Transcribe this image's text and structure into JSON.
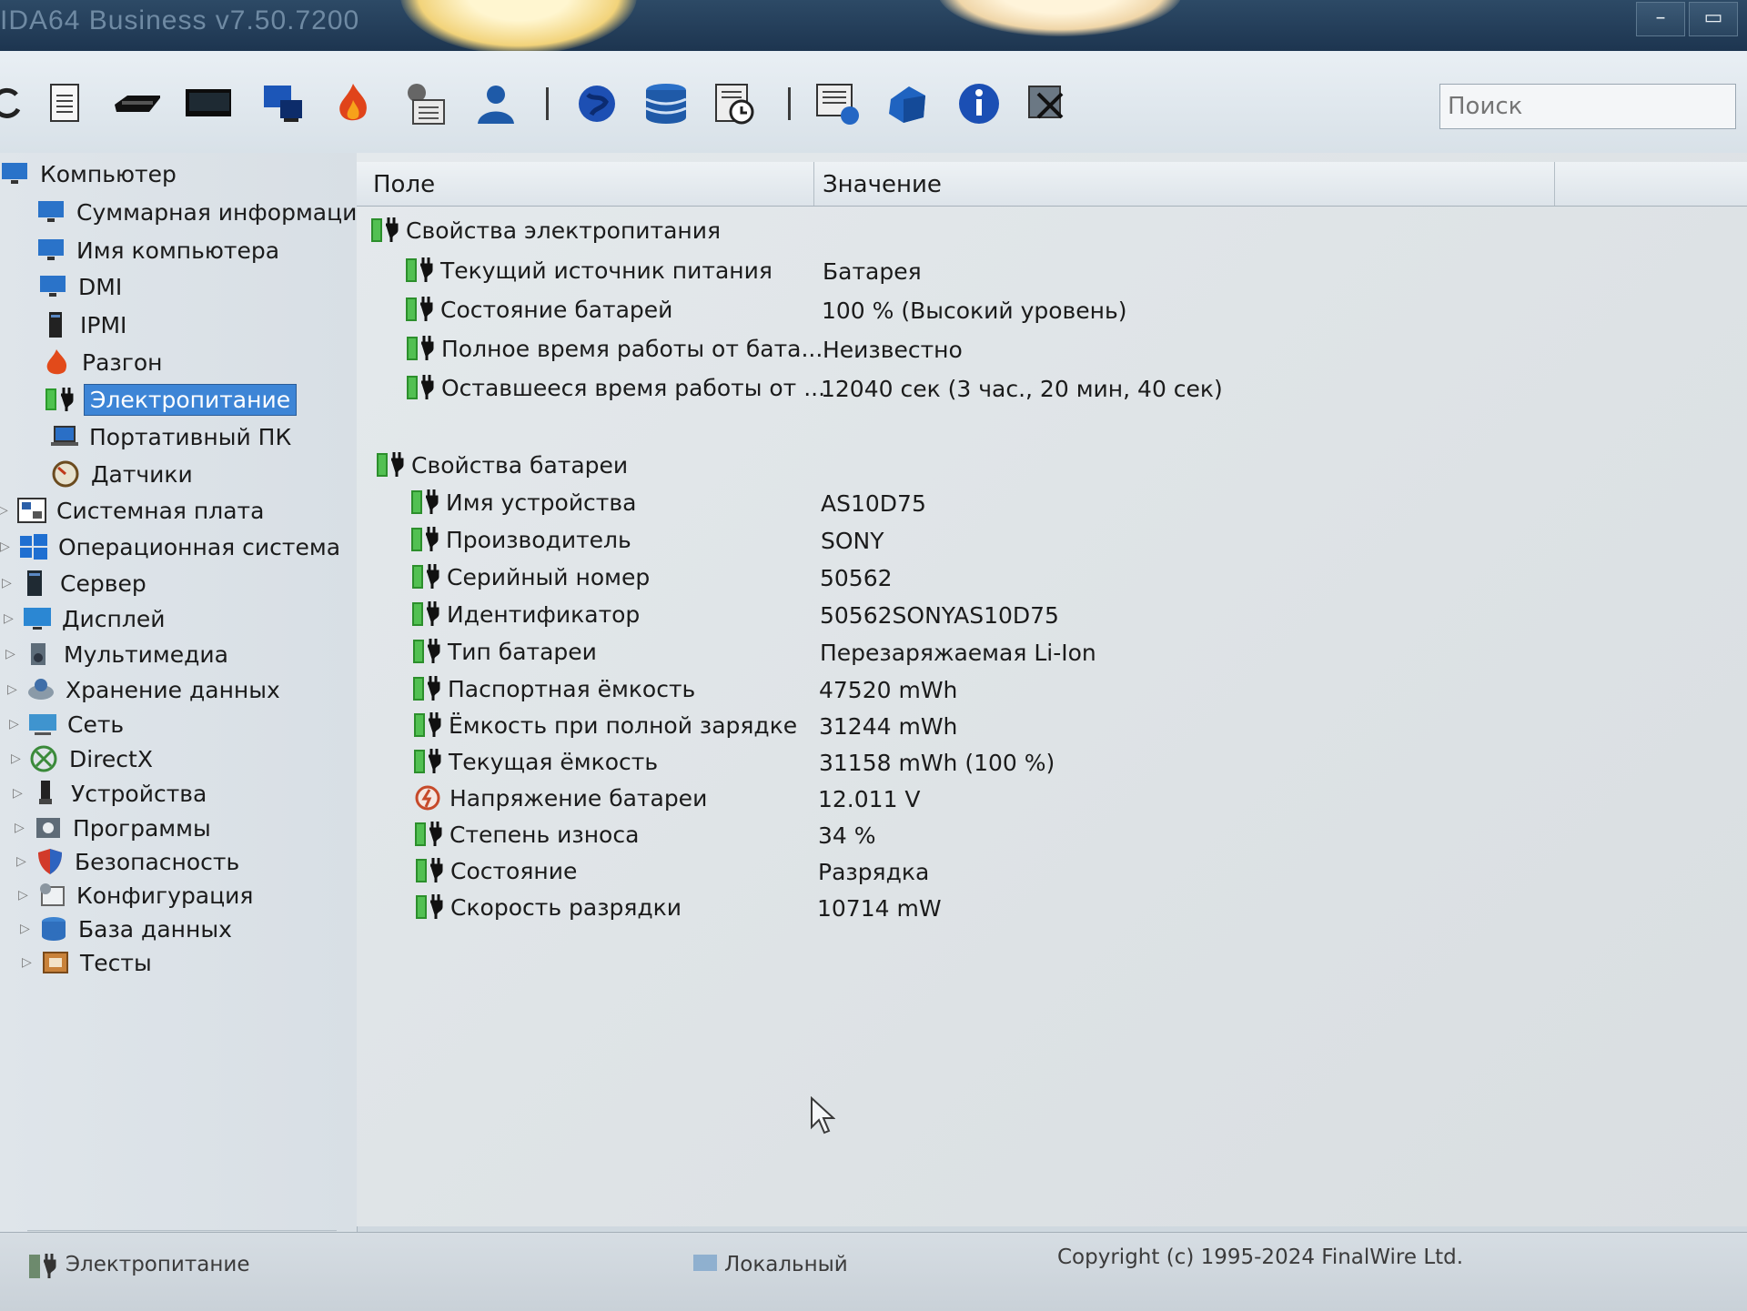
{
  "window": {
    "title": "IDA64 Business v7.50.7200"
  },
  "search": {
    "placeholder": "Поиск"
  },
  "toolbar_icons": [
    "refresh-icon",
    "report-icon",
    "memory-icon",
    "motherboard-icon",
    "computer-icon",
    "flame-icon",
    "settings-icon",
    "user-icon",
    "globe-icon",
    "database-icon",
    "schedule-icon",
    "network-report-icon",
    "network-icon",
    "info-icon",
    "tools-icon"
  ],
  "tree": {
    "root": "Компьютер",
    "computer_children": [
      {
        "label": "Суммарная информаци",
        "icon": "monitor-icon"
      },
      {
        "label": "Имя компьютера",
        "icon": "monitor-icon"
      },
      {
        "label": "DMI",
        "icon": "monitor-icon"
      },
      {
        "label": "IPMI",
        "icon": "server-icon"
      },
      {
        "label": "Разгон",
        "icon": "flame-icon"
      },
      {
        "label": "Электропитание",
        "icon": "battery-icon",
        "selected": true
      },
      {
        "label": "Портативный ПК",
        "icon": "laptop-icon"
      },
      {
        "label": "Датчики",
        "icon": "gauge-icon"
      }
    ],
    "top_level": [
      {
        "label": "Системная плата",
        "icon": "motherboard-icon"
      },
      {
        "label": "Операционная система",
        "icon": "windows-icon"
      },
      {
        "label": "Сервер",
        "icon": "server-icon"
      },
      {
        "label": "Дисплей",
        "icon": "display-icon"
      },
      {
        "label": "Мультимедиа",
        "icon": "speaker-icon"
      },
      {
        "label": "Хранение данных",
        "icon": "storage-icon"
      },
      {
        "label": "Сеть",
        "icon": "network-icon"
      },
      {
        "label": "DirectX",
        "icon": "xbox-icon"
      },
      {
        "label": "Устройства",
        "icon": "device-icon"
      },
      {
        "label": "Программы",
        "icon": "programs-icon"
      },
      {
        "label": "Безопасность",
        "icon": "shield-icon"
      },
      {
        "label": "Конфигурация",
        "icon": "config-icon"
      },
      {
        "label": "База данных",
        "icon": "database-icon"
      },
      {
        "label": "Тесты",
        "icon": "tests-icon"
      }
    ]
  },
  "table": {
    "headers": {
      "field": "Поле",
      "value": "Значение"
    },
    "group1": {
      "title": "Свойства электропитания",
      "rows": [
        {
          "field": "Текущий источник питания",
          "value": "Батарея"
        },
        {
          "field": "Состояние батарей",
          "value": "100 % (Высокий уровень)"
        },
        {
          "field": "Полное время работы от бата...",
          "value": "Неизвестно"
        },
        {
          "field": "Оставшееся время работы от ...",
          "value": "12040 сек (3 час., 20 мин, 40 сек)"
        }
      ]
    },
    "group2": {
      "title": "Свойства батареи",
      "rows": [
        {
          "field": "Имя устройства",
          "value": "AS10D75"
        },
        {
          "field": "Производитель",
          "value": "SONY"
        },
        {
          "field": "Серийный номер",
          "value": "50562"
        },
        {
          "field": "Идентификатор",
          "value": "50562SONYAS10D75"
        },
        {
          "field": "Тип батареи",
          "value": "Перезаряжаемая Li-Ion"
        },
        {
          "field": "Паспортная ёмкость",
          "value": "47520 mWh"
        },
        {
          "field": "Ёмкость при полной зарядке",
          "value": "31244 mWh"
        },
        {
          "field": "Текущая ёмкость",
          "value": "31158 mWh  (100 %)"
        },
        {
          "field": "Напряжение батареи",
          "value": "12.011 V",
          "icon": "voltage-icon"
        },
        {
          "field": "Степень износа",
          "value": "34 %"
        },
        {
          "field": "Состояние",
          "value": "Разрядка"
        },
        {
          "field": "Скорость разрядки",
          "value": "10714 mW"
        }
      ]
    }
  },
  "statusbar": {
    "left": "Электропитание",
    "middle": "Локальный",
    "right": "Copyright (c) 1995-2024 FinalWire Ltd."
  }
}
